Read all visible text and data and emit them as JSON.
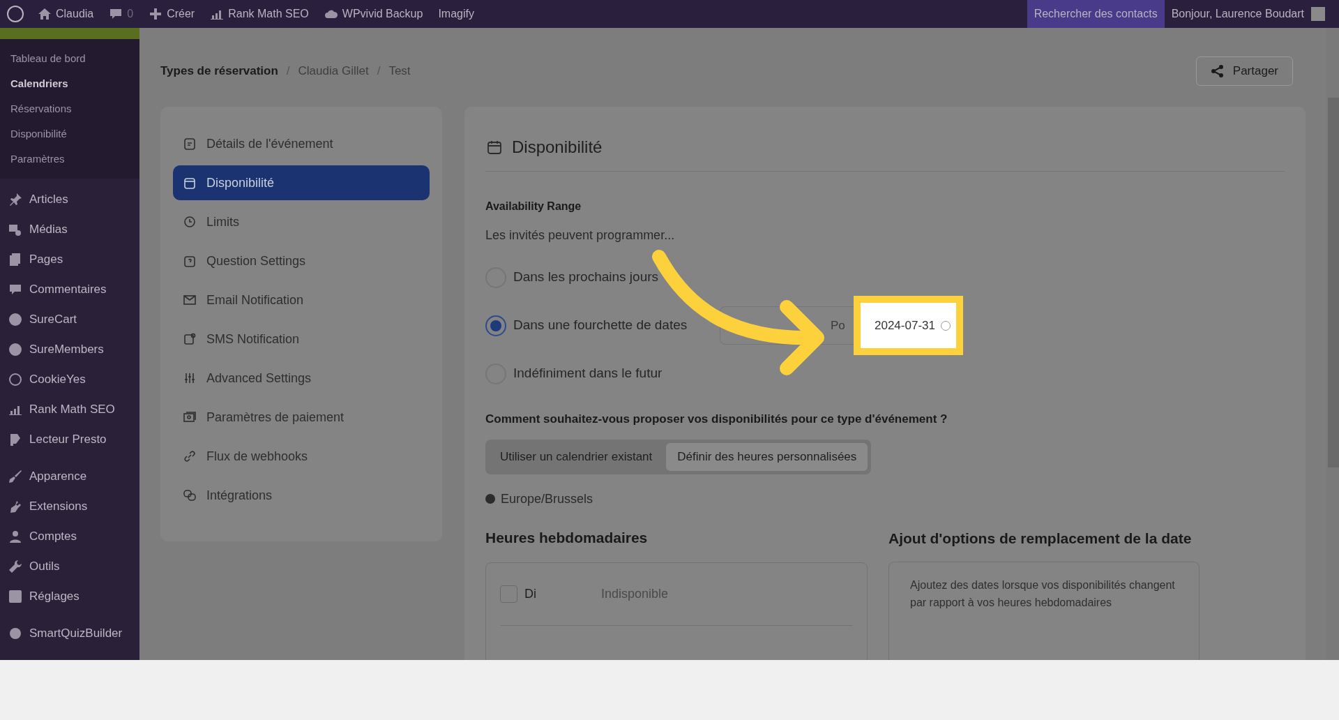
{
  "admin_bar": {
    "items": [
      {
        "label": "Claudia",
        "kind": "home"
      },
      {
        "label": "0",
        "kind": "comments"
      },
      {
        "label": "Créer",
        "kind": "plus"
      },
      {
        "label": "Rank Math SEO",
        "kind": "chart"
      },
      {
        "label": "WPvivid Backup",
        "kind": "cloud"
      },
      {
        "label": "Imagify",
        "kind": "plain"
      }
    ],
    "search": "Rechercher des contacts",
    "greeting": "Bonjour, Laurence Boudart"
  },
  "sidebar": {
    "submenu": [
      {
        "label": "Tableau de bord",
        "selected": false
      },
      {
        "label": "Calendriers",
        "selected": true
      },
      {
        "label": "Réservations",
        "selected": false
      },
      {
        "label": "Disponibilité",
        "selected": false
      },
      {
        "label": "Paramètres",
        "selected": false
      }
    ],
    "items": [
      "Articles",
      "Médias",
      "Pages",
      "Commentaires",
      "SureCart",
      "SureMembers",
      "CookieYes",
      "Rank Math SEO",
      "Lecteur Presto",
      "Apparence",
      "Extensions",
      "Comptes",
      "Outils",
      "Réglages",
      "SmartQuizBuilder"
    ]
  },
  "breadcrumb": [
    {
      "kind": "link",
      "text": "Types de réservation"
    },
    {
      "kind": "separator",
      "text": "/"
    },
    {
      "kind": "link",
      "text": "Claudia Gillet"
    },
    {
      "kind": "separator",
      "text": "/"
    },
    {
      "kind": "link",
      "text": "Test"
    }
  ],
  "share_button": "Partager",
  "settings_nav": [
    {
      "label": "Détails de l'événement",
      "selected": false
    },
    {
      "label": "Disponibilité",
      "selected": true
    },
    {
      "label": "Limits",
      "selected": false
    },
    {
      "label": "Question Settings",
      "selected": false
    },
    {
      "label": "Email Notification",
      "selected": false
    },
    {
      "label": "SMS Notification",
      "selected": false
    },
    {
      "label": "Advanced Settings",
      "selected": false
    },
    {
      "label": "Paramètres de paiement",
      "selected": false
    },
    {
      "label": "Flux de webhooks",
      "selected": false
    },
    {
      "label": "Intégrations",
      "selected": false
    }
  ],
  "panel": {
    "title": "Disponibilité",
    "range_label": "Availability Range",
    "intro": "Les invités peuvent programmer...",
    "options": [
      {
        "label": "Dans les prochains jours",
        "selected": false
      },
      {
        "label": "Dans une fourchette de dates",
        "selected": true
      },
      {
        "label": "Indéfiniment dans le futur",
        "selected": false
      }
    ],
    "date_range": {
      "separator": "Po",
      "end": "2024-07-31"
    },
    "question": "Comment souhaitez-vous proposer vos disponibilités pour ce type d'événement ?",
    "modes": [
      {
        "label": "Utiliser un calendrier existant",
        "selected": false
      },
      {
        "label": "Définir des heures personnalisées",
        "selected": true
      }
    ],
    "timezone": "Europe/Brussels",
    "weekly": {
      "title": "Heures hebdomadaires",
      "days": [
        {
          "day": "Di",
          "checked": false,
          "status": "Indisponible"
        }
      ]
    },
    "overrides": {
      "title": "Ajout d'options de remplacement de la date",
      "text": "Ajoutez des dates lorsque vos disponibilités changent par rapport à vos heures hebdomadaires"
    }
  }
}
